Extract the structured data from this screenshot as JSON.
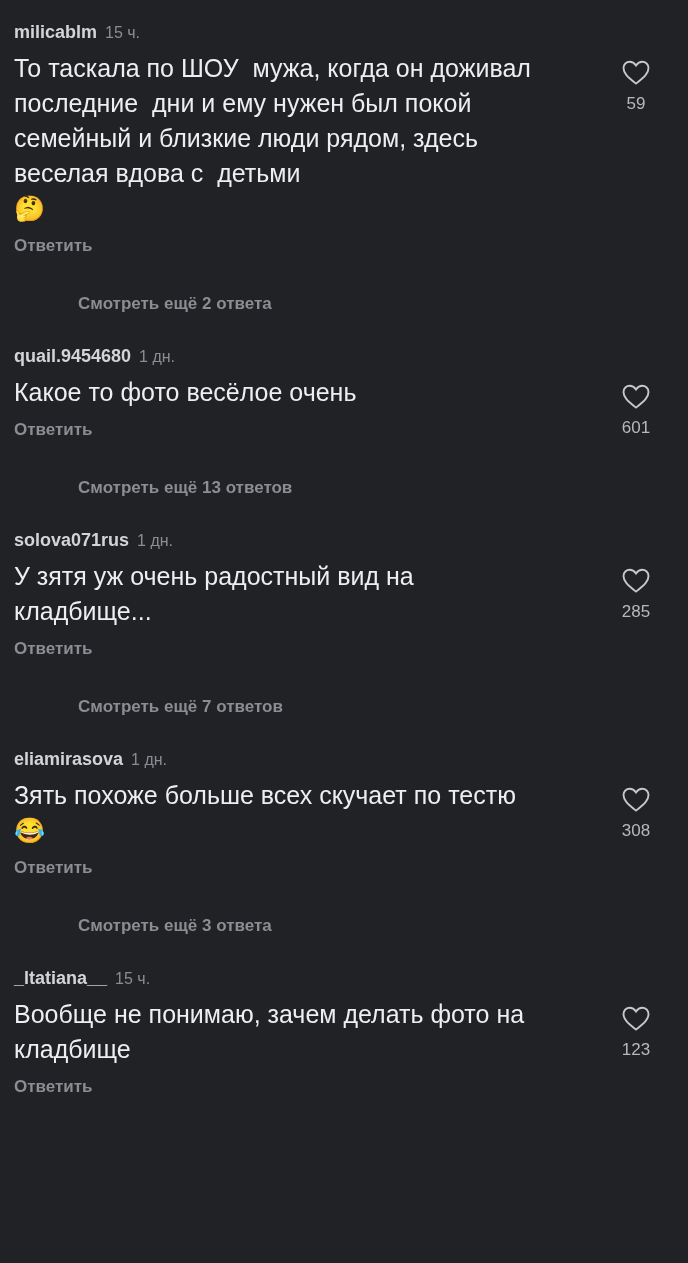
{
  "comments": [
    {
      "username": "milicablm",
      "time": "15 ч.",
      "text": "То таскала по ШОУ  мужа, когда он доживал последние  дни и ему нужен был покой семейный и близкие люди рядом, здесь  веселая вдова с  детьми\n🤔",
      "reply": "Ответить",
      "likes": "59",
      "more_replies": "Смотреть ещё 2 ответа"
    },
    {
      "username": "quail.9454680",
      "time": "1 дн.",
      "text": "Какое то фото весёлое очень",
      "reply": "Ответить",
      "likes": "601",
      "more_replies": "Смотреть ещё 13 ответов"
    },
    {
      "username": "solova071rus",
      "time": "1 дн.",
      "text": "У зятя уж очень радостный вид на кладбище...",
      "reply": "Ответить",
      "likes": "285",
      "more_replies": "Смотреть ещё 7 ответов"
    },
    {
      "username": "eliamirasova",
      "time": "1 дн.",
      "text": "Зять похоже больше всех скучает по тестю😂",
      "reply": "Ответить",
      "likes": "308",
      "more_replies": "Смотреть ещё 3 ответа"
    },
    {
      "username": "_ltatiana__",
      "time": "15 ч.",
      "text": "Вообще не понимаю, зачем делать фото на кладбище",
      "reply": "Ответить",
      "likes": "123"
    }
  ]
}
